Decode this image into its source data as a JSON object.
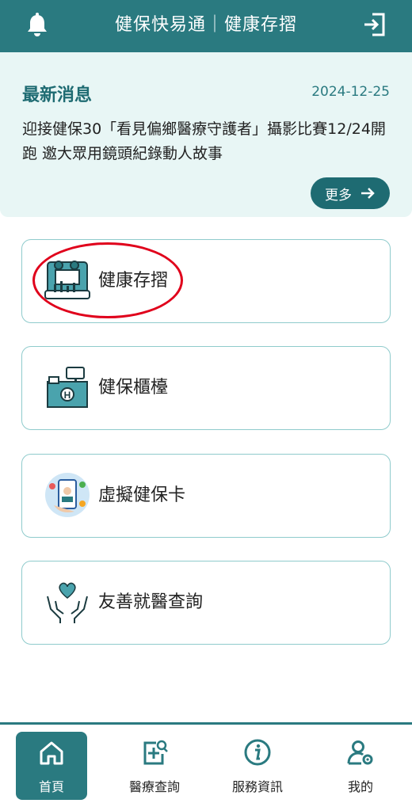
{
  "header": {
    "title": "健保快易通｜健康存摺",
    "bell_icon": "bell-icon",
    "logout_icon": "logout-icon"
  },
  "news": {
    "title": "最新消息",
    "date": "2024-12-25",
    "body": "迎接健保30「看見偏鄉醫療守護者」攝影比賽12/24開跑 邀大眾用鏡頭紀錄動人故事",
    "more_label": "更多",
    "more_icon": "arrow-right-icon"
  },
  "menu": [
    {
      "label": "健康存摺",
      "icon": "health-passbook-icon"
    },
    {
      "label": "健保櫃檯",
      "icon": "counter-icon"
    },
    {
      "label": "虛擬健保卡",
      "icon": "virtual-card-icon"
    },
    {
      "label": "友善就醫查詢",
      "icon": "caring-hands-icon"
    }
  ],
  "tabs": [
    {
      "label": "首頁",
      "icon": "home-icon",
      "active": true
    },
    {
      "label": "醫療查詢",
      "icon": "medical-search-icon",
      "active": false
    },
    {
      "label": "服務資訊",
      "icon": "info-icon",
      "active": false
    },
    {
      "label": "我的",
      "icon": "user-settings-icon",
      "active": false
    }
  ],
  "colors": {
    "primary": "#2a7a80",
    "news_bg": "#e8f6f5",
    "card_border": "#8fcbcc",
    "highlight": "#e0001b"
  }
}
